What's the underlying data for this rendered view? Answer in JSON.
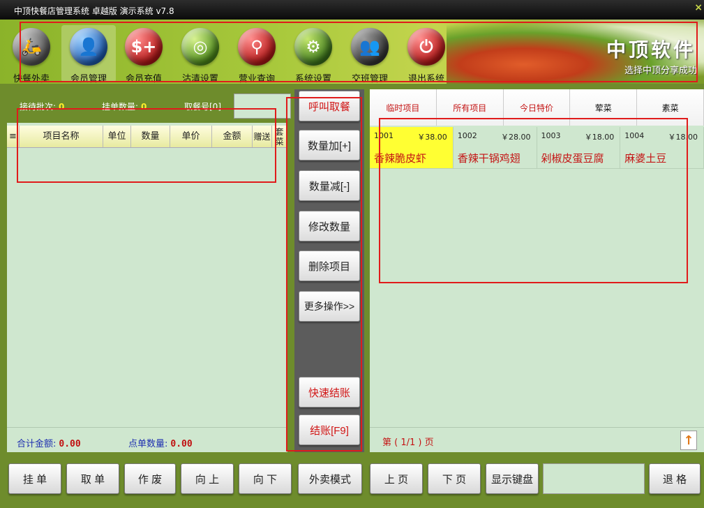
{
  "window": {
    "title": "中顶快餐店管理系统 卓越版 演示系统 v7.8",
    "close_symbol": "×"
  },
  "toolbar": {
    "items": [
      {
        "label": "快餐外卖",
        "icon": "scooter-icon",
        "glyph": "🛵"
      },
      {
        "label": "会员管理",
        "icon": "user-icon",
        "glyph": "👤"
      },
      {
        "label": "会员充值",
        "icon": "recharge-icon",
        "glyph": "$+"
      },
      {
        "label": "沽清设置",
        "icon": "plate-icon",
        "glyph": "◎"
      },
      {
        "label": "营业查询",
        "icon": "search-icon",
        "glyph": "⚲"
      },
      {
        "label": "系统设置",
        "icon": "gear-icon",
        "glyph": "⚙"
      },
      {
        "label": "交班管理",
        "icon": "people-icon",
        "glyph": "👥"
      },
      {
        "label": "退出系统",
        "icon": "power-icon",
        "glyph": "⏻"
      }
    ],
    "active_index": 1,
    "brand": "中顶软件",
    "slogan": "选择中顶分享成功"
  },
  "order_info": {
    "batch_label": "接待批次:",
    "batch_value": "0",
    "hold_label": "挂单数量:",
    "hold_value": "0",
    "pickup_label": "取餐号[0]"
  },
  "order_table": {
    "menu_icon": "≡",
    "columns": [
      "项目名称",
      "单位",
      "数量",
      "单价",
      "金额",
      "赠送",
      "套菜"
    ]
  },
  "totals": {
    "amount_label": "合计金额:",
    "amount_value": "0.00",
    "count_label": "点单数量:",
    "count_value": "0.00"
  },
  "actions": {
    "call": "呼叫取餐",
    "qty_plus": "数量加[+]",
    "qty_minus": "数量减[-]",
    "edit_qty": "修改数量",
    "delete": "删除项目",
    "more": "更多操作>>",
    "quick_checkout": "快速结账",
    "checkout": "结账[F9]"
  },
  "categories": [
    "临时项目",
    "所有项目",
    "今日特价",
    "荤菜",
    "素菜"
  ],
  "menu_items": [
    {
      "code": "1001",
      "price": "￥38.00",
      "name": "香辣脆皮虾",
      "selected": true
    },
    {
      "code": "1002",
      "price": "￥28.00",
      "name": "香辣干锅鸡翅",
      "selected": false
    },
    {
      "code": "1003",
      "price": "￥18.00",
      "name": "剁椒皮蛋豆腐",
      "selected": false
    },
    {
      "code": "1004",
      "price": "￥18.00",
      "name": "麻婆土豆",
      "selected": false
    }
  ],
  "pager": {
    "text": "第 ( 1/1 ) 页",
    "up_glyph": "↑"
  },
  "bottom": {
    "hold": "挂 单",
    "retrieve": "取 单",
    "void": "作 废",
    "up": "向 上",
    "down": "向 下",
    "takeout": "外卖模式",
    "prev_page": "上 页",
    "next_page": "下 页",
    "keyboard": "显示键盘",
    "backspace": "退 格"
  },
  "colors": {
    "accent_red": "#e01b1b",
    "panel_green": "#cfe7cf",
    "frame_olive": "#6e8c2c",
    "selected_yellow": "#ffff33"
  }
}
